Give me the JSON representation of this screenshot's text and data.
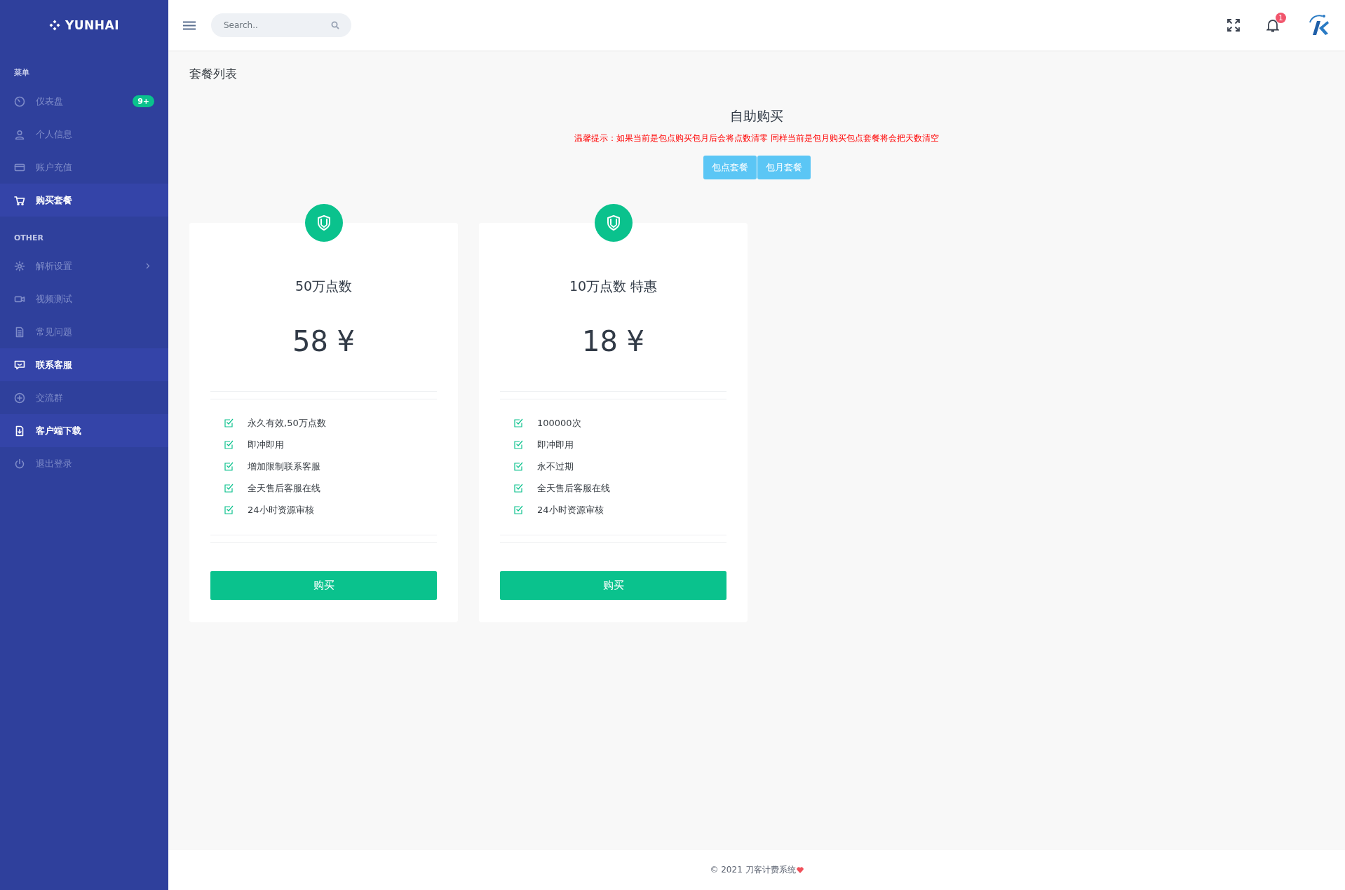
{
  "sidebar": {
    "logo": "YUNHAI",
    "sections": [
      {
        "heading": "菜单",
        "items": [
          {
            "label": "仪表盘",
            "highlighted": false,
            "badge": "9+",
            "has_submenu": false
          },
          {
            "label": "个人信息",
            "highlighted": false,
            "has_submenu": false
          },
          {
            "label": "账户充值",
            "highlighted": false,
            "has_submenu": false
          },
          {
            "label": "购买套餐",
            "highlighted": true,
            "has_submenu": false
          }
        ]
      },
      {
        "heading": "OTHER",
        "items": [
          {
            "label": "解析设置",
            "highlighted": false,
            "has_submenu": true
          },
          {
            "label": "视频测试",
            "highlighted": false,
            "has_submenu": false
          },
          {
            "label": "常见问题",
            "highlighted": false,
            "has_submenu": false
          },
          {
            "label": "联系客服",
            "highlighted": true,
            "has_submenu": false
          },
          {
            "label": "交流群",
            "highlighted": false,
            "has_submenu": false
          },
          {
            "label": "客户端下载",
            "highlighted": true,
            "has_submenu": false
          },
          {
            "label": "退出登录",
            "highlighted": false,
            "has_submenu": false
          }
        ]
      }
    ]
  },
  "topbar": {
    "search": {
      "placeholder": "Search.."
    },
    "notification_count": "1"
  },
  "page_title": "套餐列表",
  "purchase": {
    "heading": "自助购买",
    "notice": "温馨提示：如果当前是包点购买包月后会将点数清零 同样当前是包月购买包点套餐将会把天数清空",
    "tabs": [
      {
        "label": "包点套餐"
      },
      {
        "label": "包月套餐"
      }
    ],
    "plans": [
      {
        "title": "50万点数",
        "price": "58 ¥",
        "features": [
          "永久有效,50万点数",
          "即冲即用",
          "增加限制联系客服",
          "全天售后客服在线",
          "24小时资源审核"
        ],
        "button": "购买"
      },
      {
        "title": "10万点数 特惠",
        "price": "18 ¥",
        "features": [
          "100000次",
          "即冲即用",
          "永不过期",
          "全天售后客服在线",
          "24小时资源审核"
        ],
        "button": "购买"
      }
    ]
  },
  "footer": {
    "text": "© 2021 刀客计费系统"
  }
}
